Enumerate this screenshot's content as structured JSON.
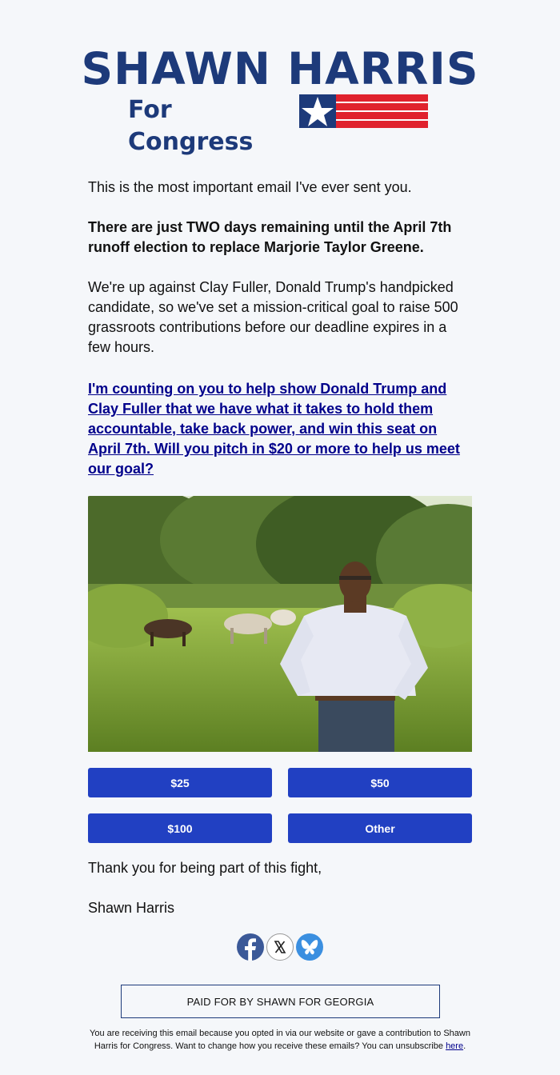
{
  "logo": {
    "name": "SHAWN HARRIS",
    "subtitle": "For Congress",
    "colors": {
      "navy": "#1d3a7a",
      "red": "#e0222d"
    }
  },
  "body": {
    "intro": "This is the most important email I've ever sent you.",
    "bold_line": "There are just TWO days remaining until the April 7th runoff election to replace Marjorie Taylor Greene.",
    "paragraph": "We're up against Clay Fuller, Donald Trump's handpicked candidate, so we've set a mission-critical goal to raise 500 grassroots contributions before our deadline expires in a few hours.",
    "link_text": "I'm counting on you to help show Donald Trump and Clay Fuller that we have what it takes to hold them accountable, take back power, and win this seat on April 7th. Will you pitch in $20 or more to help us meet our goal?"
  },
  "donate_buttons": [
    "$25",
    "$50",
    "$100",
    "Other"
  ],
  "closing": {
    "thanks": "Thank you for being part of this fight,",
    "signature": "Shawn Harris"
  },
  "socials": [
    "facebook-icon",
    "x-icon",
    "bluesky-icon"
  ],
  "paid_for": "PAID FOR BY SHAWN FOR GEORGIA",
  "footer": {
    "text": "You are receiving this email because you opted in via our website or gave a contribution to Shawn Harris for Congress. Want to change how you receive these emails? You can unsubscribe",
    "link": "here",
    "period": "."
  },
  "accent_color": "#2140c2"
}
